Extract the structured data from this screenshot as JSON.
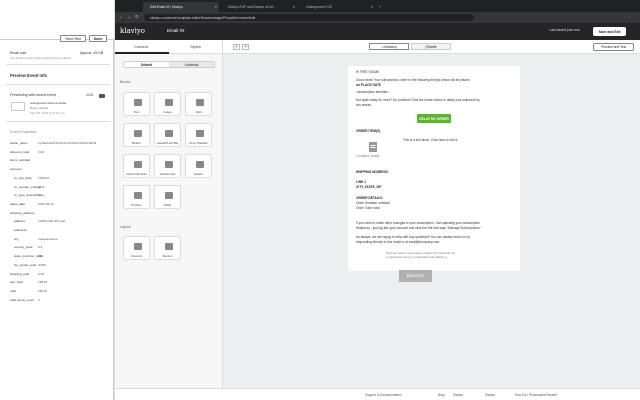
{
  "left_panel": {
    "send_test_label": "Send Test",
    "done_label": "Done",
    "email_size_label": "Email size",
    "email_size_value": "Approx. 45 KB",
    "email_size_note": "Your email is at risk of being clipped in some inboxes",
    "preview_event_title": "Preview Event Info",
    "previewing_with_label": "Previewing with recent event",
    "previewing_count": "1/10",
    "event_name": "ordergroove.order.reminder",
    "event_person": "Bryan Hobbel",
    "event_date": "May 08, 2023 at 07:52 pm",
    "event_props_label": "Event Properties",
    "props": [
      {
        "k": "action_token",
        "v": "eyJ0eXAiOiJKV1QiLCJhbGciOiJIUzI1NiJ9"
      },
      {
        "k": "discount_total",
        "v": "0.00"
      },
      {
        "k": "items_subtotal",
        "v": ""
      },
      {
        "k": "payment",
        "v": ""
      },
      {
        "k": "cc_exp_date",
        "v": "12/2027"
      },
      {
        "k": "cc_number_ending",
        "v": "4111"
      },
      {
        "k": "cc_type_description",
        "v": "Visa"
      },
      {
        "k": "place_date",
        "v": "2023-05-12"
      },
      {
        "k": "shipping_address",
        "v": ""
      },
      {
        "k": "address",
        "v": "10186 Oak Hill road"
      },
      {
        "k": "address2",
        "v": ""
      },
      {
        "k": "city",
        "v": "Independence"
      },
      {
        "k": "country_code",
        "v": "US"
      },
      {
        "k": "state_province_code",
        "v": "OR"
      },
      {
        "k": "zip_postal_code",
        "v": "97351"
      },
      {
        "k": "shipping_total",
        "v": "0.00"
      },
      {
        "k": "sub_total",
        "v": "158.00"
      },
      {
        "k": "total",
        "v": "253.00"
      },
      {
        "k": "total_items_count",
        "v": "2"
      }
    ]
  },
  "browser": {
    "tabs": [
      {
        "label": "Edit Email #2 | Klaviyo",
        "active": true
      },
      {
        "label": "Klaviyo ESP and Klaviyo v2 Int...",
        "active": false
      },
      {
        "label": "Ordergroove KCS",
        "active": false
      }
    ],
    "url": "klaviyo.com/email-template-editor/flow/message/PhwpdtX/content/edit"
  },
  "app": {
    "logo": "klaviyo",
    "email_title": "Email #2",
    "saved_text": "Last saved just now",
    "save_exit_label": "Save and Exit"
  },
  "editor_sidebar": {
    "tabs": [
      "Content",
      "Styles"
    ],
    "modes": [
      "Default",
      "Universal"
    ],
    "blocks_label": "Blocks",
    "blocks": [
      "Text",
      "Image",
      "Split",
      "Button",
      "Header/Link Bar",
      "Drop Shadow",
      "Horizontal Rule",
      "Social Links",
      "Spacer",
      "Product",
      "Table"
    ],
    "layout_label": "Layout",
    "layouts": [
      "Columns",
      "Section"
    ]
  },
  "canvas": {
    "view_desktop": "Desktop",
    "view_mobile": "Mobile",
    "preview_test_label": "Preview and Test",
    "email_lines": [
      "Hi FIRST NAME",
      "Good news! Your subscription order for the following item(s) below will be placed",
      "on PLACE DATE",
      "<subscription benefits>",
      "Not quite ready for more? No problem! Click the button below to delay your shipment by",
      "two weeks."
    ],
    "cta_label": "DELAY MY ORDER",
    "order_items_label": "ORDER ITEM(S)",
    "configure_image": "Configure Image",
    "text_block_note": "This is a text block. Click here to edit it.",
    "shipping_label": "SHIPPING ADDRESS:",
    "line1": "LINE 1",
    "city_line": "CITY, STATE, ZIP",
    "order_details_label": "ORDER DETAILS:",
    "subtotal_line": "Order Subtotal: subtotal",
    "total_line": "Order Total: total",
    "change_note_1": "If you need to make other changes to your subscription - like adjusting your subscription",
    "change_note_2": "frequency - just log into your account and click the link that says \"Manage Subscriptions.\"",
    "help_note_1": "As always, we are happy to help with any questions! You can always reach us by",
    "help_note_2": "responding directly to this email or at email@company.com.",
    "unsub_1": "No longer want to receive these emails? {% unsubscribe %}",
    "unsub_2": "{{ organization.name }} {{ organization.full_address }}",
    "footer_logo": "klaviyo"
  },
  "bottom_bar": {
    "links": [
      "Support & Documentation",
      "Blog",
      "Klaviyo",
      "Klaviyo",
      "How Do I Personalize Emails?"
    ]
  }
}
